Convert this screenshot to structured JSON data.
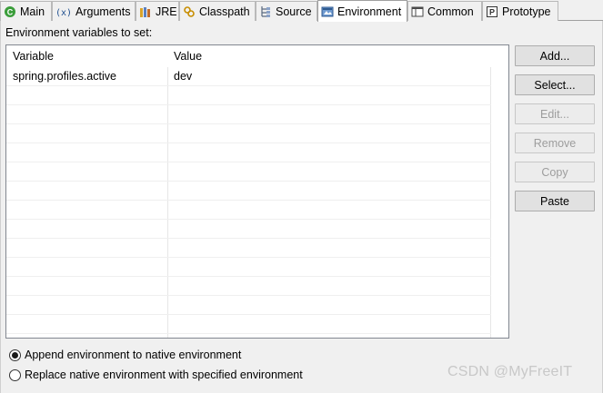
{
  "tabs": [
    {
      "label": "Main",
      "icon": "main-icon"
    },
    {
      "label": "Arguments",
      "icon": "arguments-icon"
    },
    {
      "label": "JRE",
      "icon": "jre-icon"
    },
    {
      "label": "Classpath",
      "icon": "classpath-icon"
    },
    {
      "label": "Source",
      "icon": "source-icon"
    },
    {
      "label": "Environment",
      "icon": "environment-icon",
      "selected": true
    },
    {
      "label": "Common",
      "icon": "common-icon"
    },
    {
      "label": "Prototype",
      "icon": "prototype-icon"
    }
  ],
  "environment": {
    "section_label": "Environment variables to set:",
    "columns": {
      "variable": "Variable",
      "value": "Value"
    },
    "rows": [
      {
        "variable": "spring.profiles.active",
        "value": "dev"
      }
    ],
    "buttons": {
      "add": "Add...",
      "select": "Select...",
      "edit": "Edit...",
      "remove": "Remove",
      "copy": "Copy",
      "paste": "Paste"
    },
    "options": {
      "append": "Append environment to native environment",
      "replace": "Replace native environment with specified environment",
      "selected": "append"
    }
  },
  "watermark": "CSDN @MyFreeIT",
  "colors": {
    "main_icon": "#3a9d3a",
    "disabled_text": "#9d9d9d",
    "table_border": "#828790"
  }
}
